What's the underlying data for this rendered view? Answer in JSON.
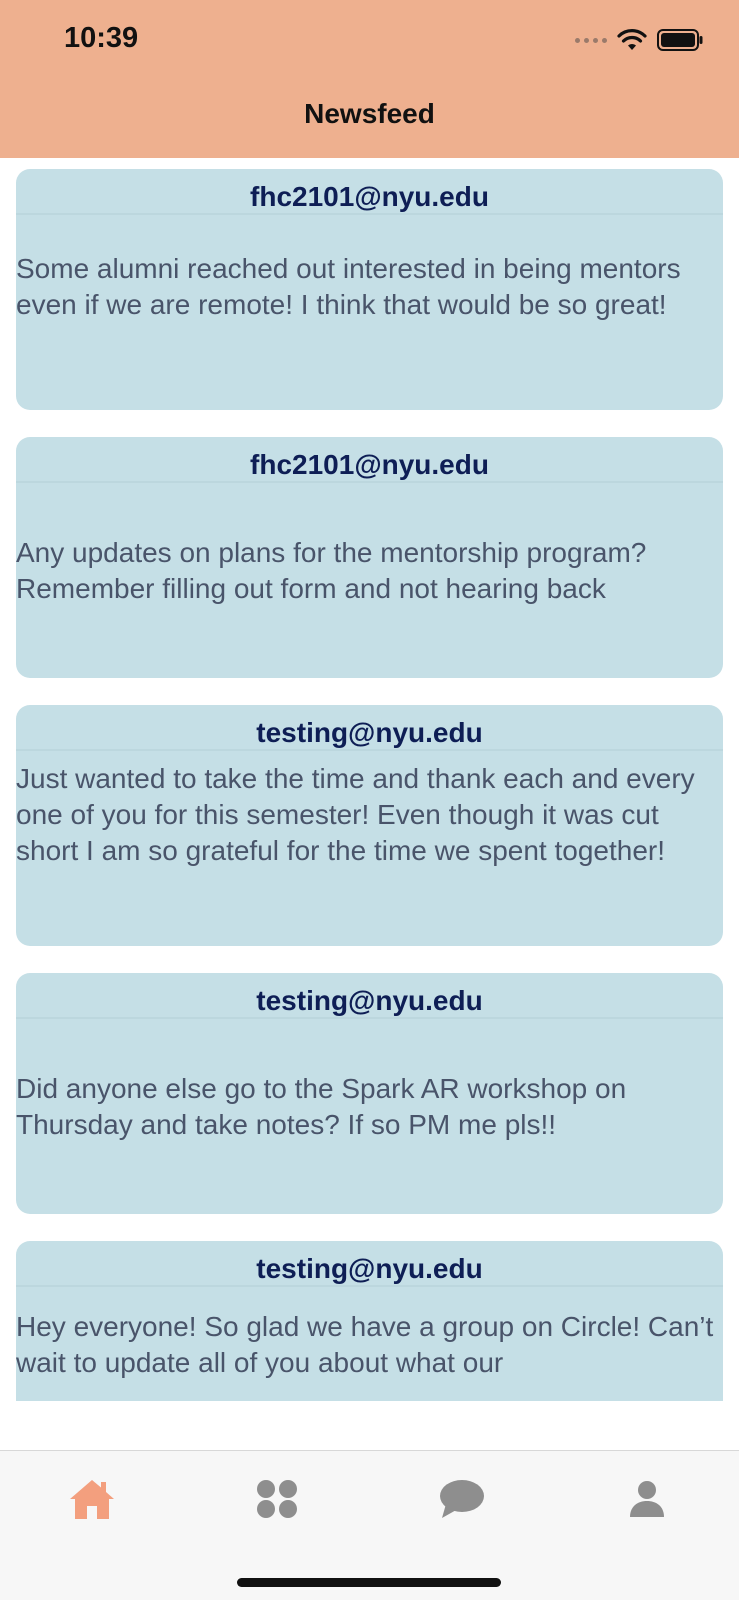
{
  "status_bar": {
    "time": "10:39"
  },
  "header": {
    "title": "Newsfeed"
  },
  "posts": [
    {
      "author": "fhc2101@nyu.edu",
      "text": "Some alumni reached out interested in being mentors even if we are remote! I think that would be so great!"
    },
    {
      "author": "fhc2101@nyu.edu",
      "text": "Any updates on plans for the mentorship program? Remember filling out form and not hearing back"
    },
    {
      "author": "testing@nyu.edu",
      "text": "Just wanted to take the time and thank each and every one of you for this semester! Even though it was cut short I am so grateful for the time we spent together!"
    },
    {
      "author": "testing@nyu.edu",
      "text": "Did anyone else go to the Spark AR workshop on Thursday and take notes? If so PM me pls!!"
    },
    {
      "author": "testing@nyu.edu",
      "text": "Hey everyone! So glad we have a group on Circle! Can’t wait to update all of you about what our"
    }
  ],
  "tabbar": {
    "items": [
      {
        "icon": "home-icon",
        "active": true
      },
      {
        "icon": "groups-icon",
        "active": false
      },
      {
        "icon": "chat-icon",
        "active": false
      },
      {
        "icon": "profile-icon",
        "active": false
      }
    ]
  },
  "colors": {
    "header_bg": "#eeb08f",
    "card_bg": "#c5dfe6",
    "author_text": "#0e1e55",
    "body_text": "#49546a",
    "tab_active": "#f39f7e",
    "tab_inactive": "#8e8e8e"
  }
}
